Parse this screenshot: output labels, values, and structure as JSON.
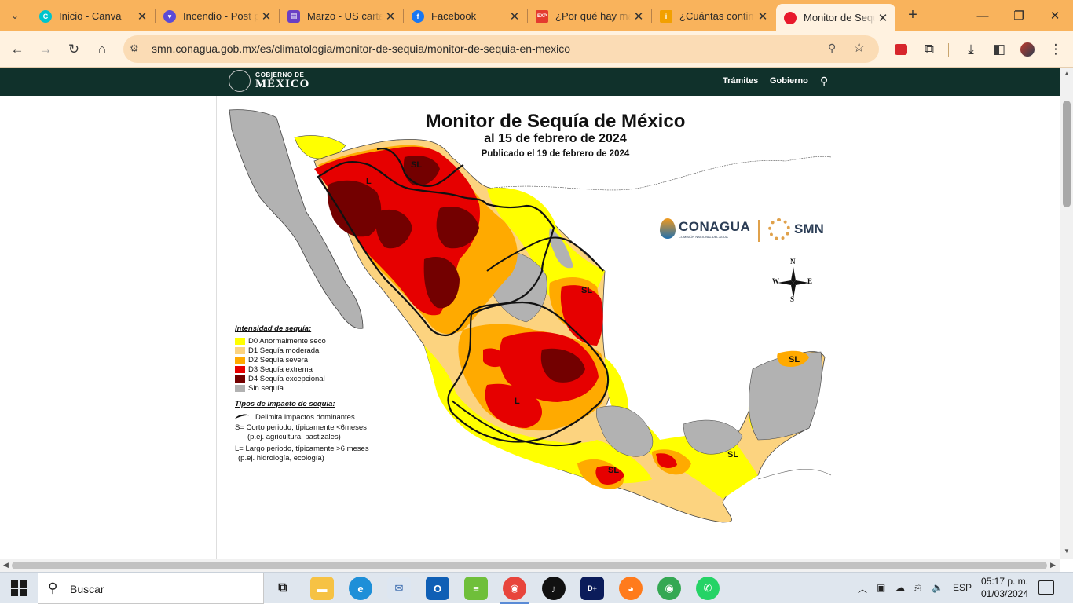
{
  "browser": {
    "tabs": [
      {
        "title": "Inicio - Canva",
        "icon": "canva-icon",
        "color": "#00c4cc",
        "glyph": "C"
      },
      {
        "title": "Incendio - Post p",
        "icon": "heart-icon",
        "color": "#5b4bd6",
        "glyph": "♥"
      },
      {
        "title": "Marzo - US carta",
        "icon": "printer-icon",
        "color": "#6a3fc4",
        "glyph": "▤"
      },
      {
        "title": "Facebook",
        "icon": "facebook-icon",
        "color": "#1877f2",
        "glyph": "f"
      },
      {
        "title": "¿Por qué hay má",
        "icon": "exp-icon",
        "color": "#e43a2f",
        "glyph": "EXP"
      },
      {
        "title": "¿Cuántas contin",
        "icon": "info-icon",
        "color": "#f2a000",
        "glyph": "i"
      },
      {
        "title": "Monitor de Sequ",
        "icon": "red-dot-icon",
        "color": "#e8192c",
        "glyph": ""
      }
    ],
    "active_tab": 6,
    "url": "smn.conagua.gob.mx/es/climatologia/monitor-de-sequia/monitor-de-sequia-en-mexico"
  },
  "site": {
    "logo_line1": "GOBIERNO DE",
    "logo_line2": "MÉXICO",
    "nav": [
      "Trámites",
      "Gobierno"
    ]
  },
  "map": {
    "title": "Monitor de Sequía de México",
    "subtitle": "al 15 de febrero de 2024",
    "published": "Publicado el 19 de febrero de 2024",
    "conagua": "CONAGUA",
    "conagua_sub": "COMISIÓN NACIONAL DEL AGUA",
    "smn": "SMN",
    "compass": {
      "n": "N",
      "s": "S",
      "e": "E",
      "w": "W"
    },
    "region_labels": {
      "l1": "L",
      "sl1": "SL",
      "sl2": "SL",
      "l2": "L",
      "sl3": "SL",
      "sl4": "SL",
      "sl5": "SL"
    },
    "legend": {
      "heading": "Intensidad de sequía:",
      "items": [
        {
          "label": "D0 Anormalmente seco",
          "color": "#ffff00"
        },
        {
          "label": "D1 Sequía moderada",
          "color": "#fcd37f"
        },
        {
          "label": "D2 Sequía severa",
          "color": "#ffaa00"
        },
        {
          "label": "D3 Sequía extrema",
          "color": "#e60000"
        },
        {
          "label": "D4 Sequía excepcional",
          "color": "#730000"
        },
        {
          "label": "Sin sequía",
          "color": "#b2b2b2"
        }
      ],
      "impact_heading": "Tipos de impacto de sequía:",
      "impact_line": "Delimita impactos dominantes",
      "short_term": "S= Corto periodo, típicamente <6meses",
      "short_term_ex": "(p.ej. agricultura, pastizales)",
      "long_term": "L= Largo periodo, típicamente >6 meses",
      "long_term_ex": "(p.ej. hidrología, ecología)"
    }
  },
  "taskbar": {
    "search_placeholder": "Buscar",
    "language": "ESP",
    "time": "05:17 p. m.",
    "date": "01/03/2024"
  }
}
